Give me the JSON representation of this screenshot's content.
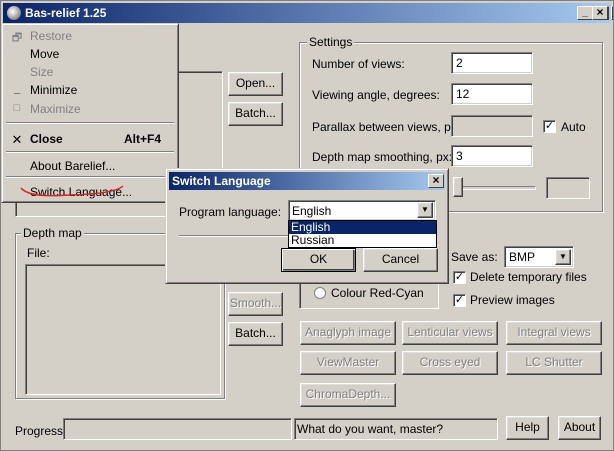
{
  "window": {
    "title": "Bas-relief 1.25",
    "controls": [
      "_",
      "□",
      "×"
    ]
  },
  "system_menu": {
    "items": [
      {
        "label": "Restore",
        "enabled": false,
        "icon": "restore-icon"
      },
      {
        "label": "Move",
        "enabled": true
      },
      {
        "label": "Size",
        "enabled": false
      },
      {
        "label": "Minimize",
        "enabled": true,
        "icon": "minimize-icon"
      },
      {
        "label": "Maximize",
        "enabled": false,
        "icon": "maximize-icon"
      },
      {
        "label": "Close",
        "shortcut": "Alt+F4",
        "enabled": true,
        "icon": "close-icon"
      },
      {
        "label": "About Barelief...",
        "enabled": true
      },
      {
        "label": "Switch Language...",
        "enabled": true
      }
    ]
  },
  "source_panel": {
    "open_button": "Open...",
    "batch_button": "Batch..."
  },
  "depth_map": {
    "group_label": "Depth map",
    "file_label": "File:",
    "smooth_button": "Smooth...",
    "batch_button": "Batch..."
  },
  "settings": {
    "group_label": "Settings",
    "num_views_label": "Number of views:",
    "num_views_value": "2",
    "view_angle_label": "Viewing angle, degrees:",
    "view_angle_value": "12",
    "parallax_label": "Parallax between views, px:",
    "parallax_value": "",
    "auto_label": "Auto",
    "auto_checked": true,
    "smoothing_label": "Depth map smoothing, px:",
    "smoothing_value": "3",
    "slider_value_text": ""
  },
  "output": {
    "save_as_label": "Save as:",
    "save_as_value": "BMP",
    "delete_temp_label": "Delete temporary files",
    "delete_temp_checked": true,
    "preview_label": "Preview images",
    "preview_checked": true,
    "colour_radio_label": "Colour Red-Cyan"
  },
  "render_buttons": [
    "Anaglyph image",
    "Lenticular views",
    "Integral views",
    "ViewMaster",
    "Cross eyed",
    "LC Shutter",
    "ChromaDepth..."
  ],
  "status": {
    "progress_label": "Progress:",
    "message": "What do you want, master?",
    "help_button": "Help",
    "about_button": "About"
  },
  "dialog": {
    "title": "Switch Language",
    "program_language_label": "Program language:",
    "selected_language": "English",
    "options": [
      "English",
      "Russian"
    ],
    "ok_button": "OK",
    "cancel_button": "Cancel"
  },
  "colors": {
    "title_bar_start": "#0a246a",
    "title_bar_end": "#a6caf0",
    "face": "#d4d0c8",
    "annotation_red": "#e02020"
  }
}
